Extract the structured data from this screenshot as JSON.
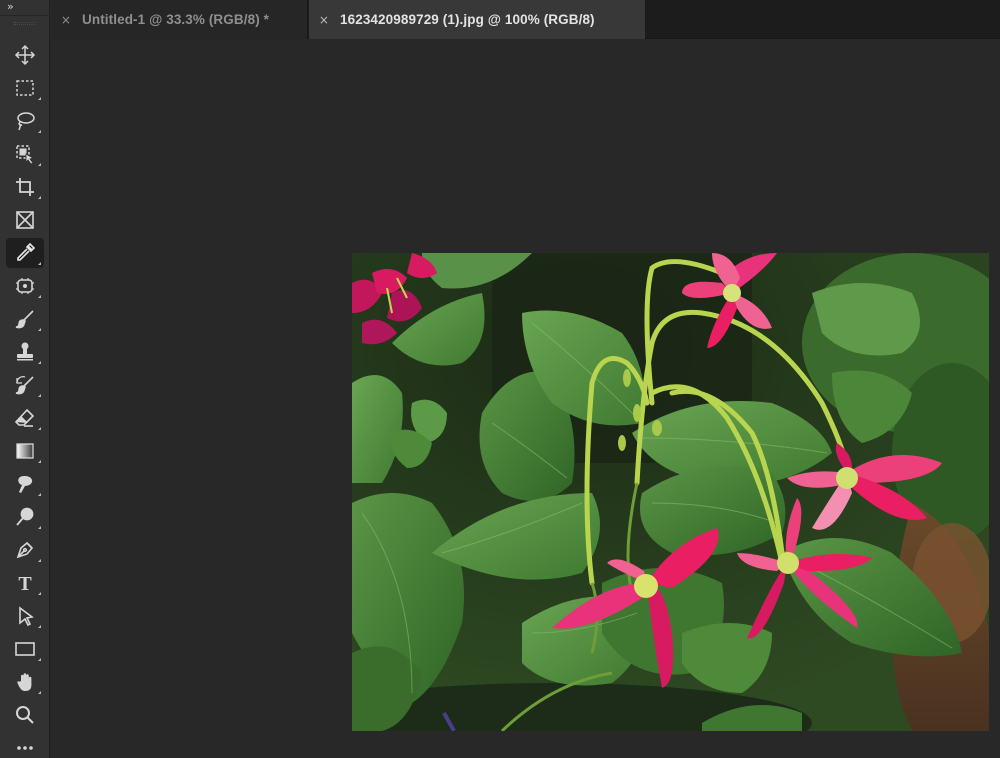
{
  "toolbar": {
    "collapse_glyph": "»",
    "active_tool": "eyedropper-tool",
    "tools": [
      {
        "name": "move-tool",
        "icon": "move-icon"
      },
      {
        "name": "rectangular-marquee-tool",
        "icon": "marquee-icon"
      },
      {
        "name": "lasso-tool",
        "icon": "lasso-icon"
      },
      {
        "name": "object-selection-tool",
        "icon": "object-selection-icon"
      },
      {
        "name": "crop-tool",
        "icon": "crop-icon"
      },
      {
        "name": "frame-tool",
        "icon": "frame-icon"
      },
      {
        "name": "eyedropper-tool",
        "icon": "eyedropper-icon"
      },
      {
        "name": "spot-healing-brush-tool",
        "icon": "healing-icon"
      },
      {
        "name": "brush-tool",
        "icon": "brush-icon"
      },
      {
        "name": "clone-stamp-tool",
        "icon": "stamp-icon"
      },
      {
        "name": "history-brush-tool",
        "icon": "history-brush-icon"
      },
      {
        "name": "eraser-tool",
        "icon": "eraser-icon"
      },
      {
        "name": "gradient-tool",
        "icon": "gradient-icon"
      },
      {
        "name": "blur-tool",
        "icon": "blur-icon"
      },
      {
        "name": "dodge-tool",
        "icon": "dodge-icon"
      },
      {
        "name": "pen-tool",
        "icon": "pen-icon"
      },
      {
        "name": "type-tool",
        "icon": "type-icon"
      },
      {
        "name": "path-selection-tool",
        "icon": "path-selection-icon"
      },
      {
        "name": "rectangle-tool",
        "icon": "rectangle-icon"
      },
      {
        "name": "hand-tool",
        "icon": "hand-icon"
      },
      {
        "name": "zoom-tool",
        "icon": "zoom-icon"
      },
      {
        "name": "edit-toolbar",
        "icon": "more-icon"
      }
    ],
    "type_glyph": "T"
  },
  "tabs": [
    {
      "close": "×",
      "label": "Untitled-1 @ 33.3% (RGB/8) *",
      "active": false
    },
    {
      "close": "×",
      "label": "1623420989729 (1).jpg @ 100% (RGB/8)",
      "active": true
    }
  ],
  "colors": {
    "app_background": "#282828",
    "toolbar": "#323232",
    "tab_active": "#383838",
    "tab_inactive": "#262626",
    "icon": "#d6d6d6",
    "flower_pink": "#e0246c",
    "leaf_green": "#4f8a3a",
    "stem_green": "#b5cf4a"
  }
}
